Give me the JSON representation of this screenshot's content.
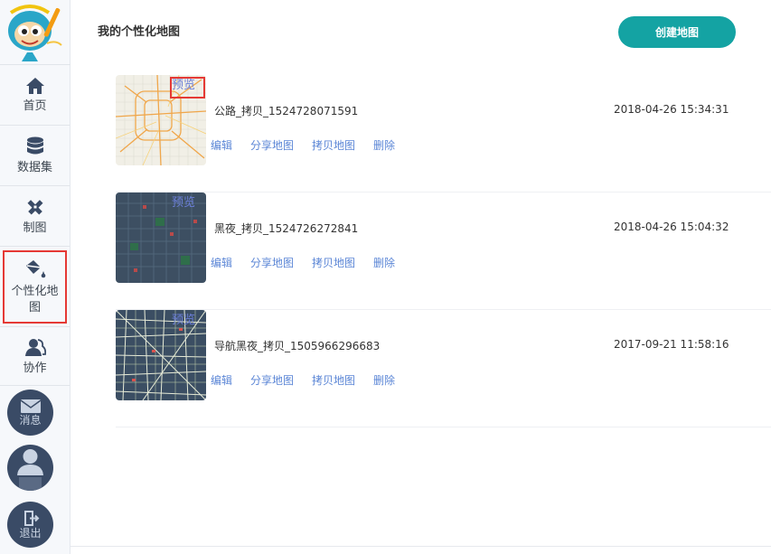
{
  "sidebar": {
    "items": [
      {
        "label": "首页",
        "icon": "home-icon"
      },
      {
        "label": "数据集",
        "icon": "database-icon"
      },
      {
        "label": "制图",
        "icon": "pen-ruler-icon"
      },
      {
        "label": "个性化地图",
        "icon": "paint-bucket-icon"
      },
      {
        "label": "协作",
        "icon": "people-icon"
      }
    ],
    "message_label": "消息",
    "exit_label": "退出"
  },
  "main": {
    "title": "我的个性化地图",
    "create_button": "创建地图",
    "preview_label": "预览",
    "actions": {
      "edit": "编辑",
      "share": "分享地图",
      "copy": "拷贝地图",
      "delete": "删除"
    },
    "maps": [
      {
        "name": "公路_拷贝_1524728071591",
        "date": "2018-04-26 15:34:31",
        "theme": "light"
      },
      {
        "name": "黑夜_拷贝_1524726272841",
        "date": "2018-04-26 15:04:32",
        "theme": "dark"
      },
      {
        "name": "导航黑夜_拷贝_1505966296683",
        "date": "2017-09-21 11:58:16",
        "theme": "navigation-dark"
      }
    ]
  },
  "colors": {
    "accent": "#14a3a3",
    "link": "#5b86d6",
    "highlight": "#e53935",
    "sidebar_round": "#3a4b66"
  }
}
